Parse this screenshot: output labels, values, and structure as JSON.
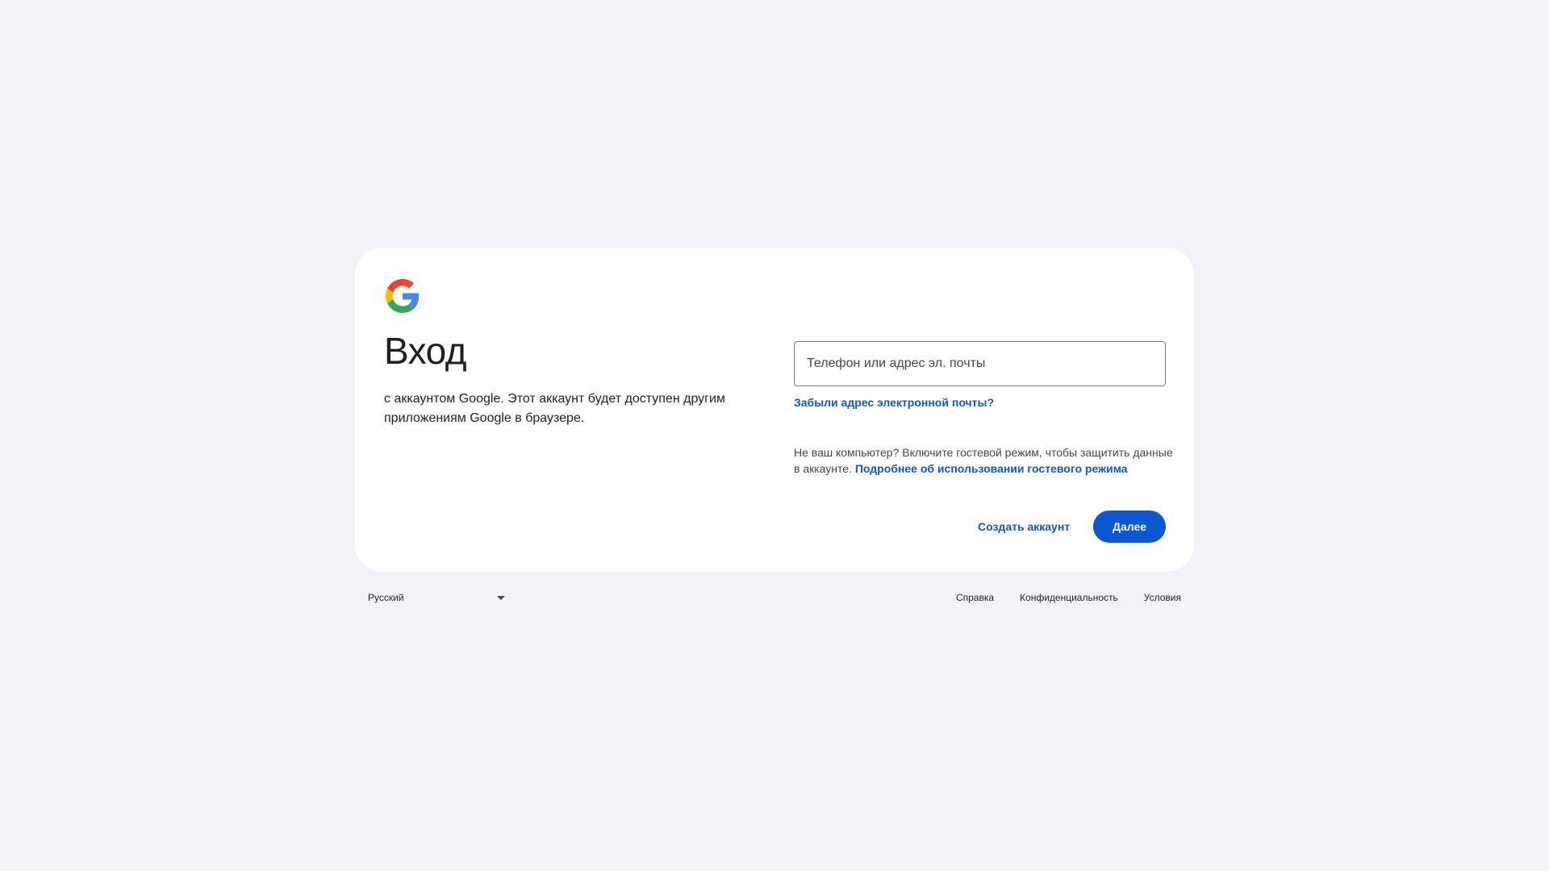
{
  "colors": {
    "background": "#f0f4f9",
    "card": "#ffffff",
    "accent": "#0b57d0",
    "text": "#1f1f1f"
  },
  "logo": {
    "icon": "google-g-icon"
  },
  "signin": {
    "title": "Вход",
    "subtitle": "с аккаунтом Google. Этот аккаунт будет доступен другим приложениям Google в браузере."
  },
  "form": {
    "email_placeholder": "Телефон или адрес эл. почты",
    "email_value": "",
    "forgot_link": "Забыли адрес электронной почты?",
    "guest_text": "Не ваш компьютер? Включите гостевой режим, чтобы защитить данные в аккаунте.",
    "guest_link": "Подробнее об использовании гостевого режима",
    "create_account": "Создать аккаунт",
    "next": "Далее"
  },
  "footer": {
    "language": "Русский",
    "language_icon": "chevron-down-icon",
    "links": {
      "help": "Справка",
      "privacy": "Конфиденциальность",
      "terms": "Условия"
    }
  }
}
